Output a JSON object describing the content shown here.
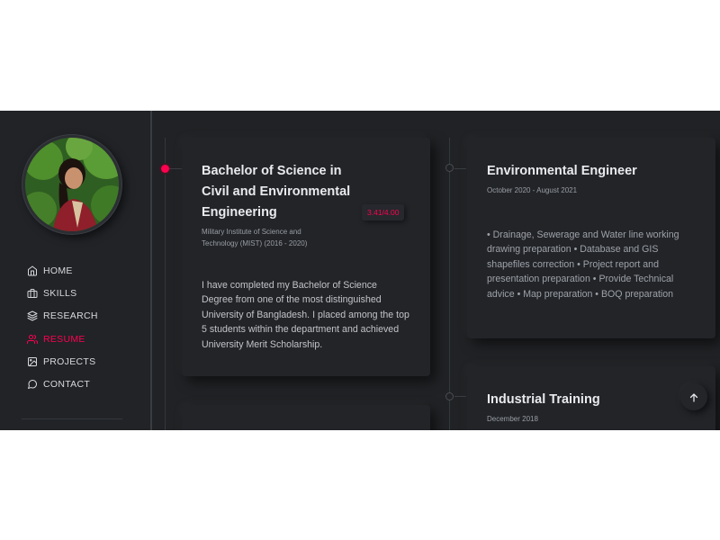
{
  "colors": {
    "accent": "#ff014f",
    "background": "#202225",
    "text": "#d7d9dd"
  },
  "sidebar": {
    "avatar": "profile-photo",
    "nav": [
      {
        "label": "HOME",
        "icon": "home-icon",
        "active": false
      },
      {
        "label": "SKILLS",
        "icon": "briefcase-icon",
        "active": false
      },
      {
        "label": "RESEARCH",
        "icon": "layers-icon",
        "active": false
      },
      {
        "label": "RESUME",
        "icon": "users-icon",
        "active": true
      },
      {
        "label": "PROJECTS",
        "icon": "image-icon",
        "active": false
      },
      {
        "label": "CONTACT",
        "icon": "message-circle-icon",
        "active": false
      }
    ]
  },
  "education": {
    "title_line1": "Bachelor of Science in",
    "title_line2": "Civil and Environmental",
    "title_line3": "Engineering",
    "institution_line1": "Military Institute of Science and",
    "institution_line2": "Technology (MIST) (2016 - 2020)",
    "grade": "3.41/4.00",
    "description": "I have completed my Bachelor of Science Degree from one of the most distinguished University of Bangladesh. I placed among the top 5 students within the department and achieved University Merit Scholarship."
  },
  "experience": [
    {
      "title": "Environmental Engineer",
      "date": "October 2020 - August 2021",
      "description": "• Drainage, Sewerage and Water line working drawing preparation • Database and GIS shapefiles correction • Project report and presentation preparation • Provide Technical advice • Map preparation • BOQ preparation"
    },
    {
      "title": "Industrial Training",
      "date": "December 2018"
    }
  ],
  "scroll_top": {
    "icon": "arrow-up-icon"
  }
}
